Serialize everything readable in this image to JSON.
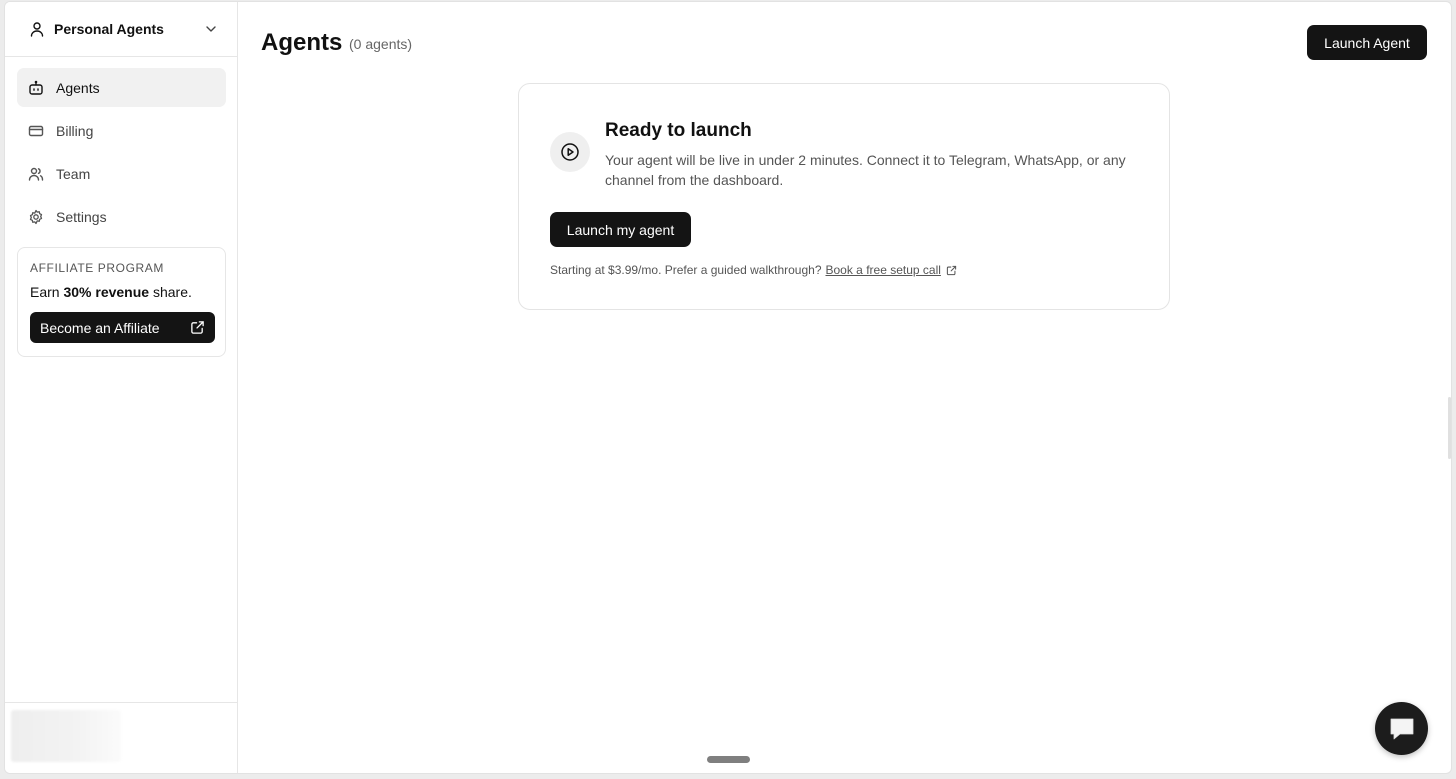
{
  "sidebar": {
    "workspace": {
      "label": "Personal Agents",
      "icon": "user-icon"
    },
    "items": [
      {
        "label": "Agents",
        "icon": "robot-icon",
        "active": true
      },
      {
        "label": "Billing",
        "icon": "credit-card-icon",
        "active": false
      },
      {
        "label": "Team",
        "icon": "users-icon",
        "active": false
      },
      {
        "label": "Settings",
        "icon": "gear-icon",
        "active": false
      }
    ],
    "affiliate": {
      "title": "AFFILIATE PROGRAM",
      "desc_prefix": "Earn ",
      "desc_bold": "30% revenue",
      "desc_suffix": " share.",
      "button_label": "Become an Affiliate"
    }
  },
  "main": {
    "title": "Agents",
    "count": "(0 agents)",
    "launch_button": "Launch Agent",
    "card": {
      "title": "Ready to launch",
      "description": "Your agent will be live in under 2 minutes. Connect it to Telegram, WhatsApp, or any channel from the dashboard.",
      "button_label": "Launch my agent",
      "footer_text": "Starting at $3.99/mo. Prefer a guided walkthrough?",
      "footer_link": "Book a free setup call"
    }
  },
  "colors": {
    "primary_button": "#141414",
    "active_nav_bg": "#f1f1f1",
    "border": "#e4e4e4"
  }
}
